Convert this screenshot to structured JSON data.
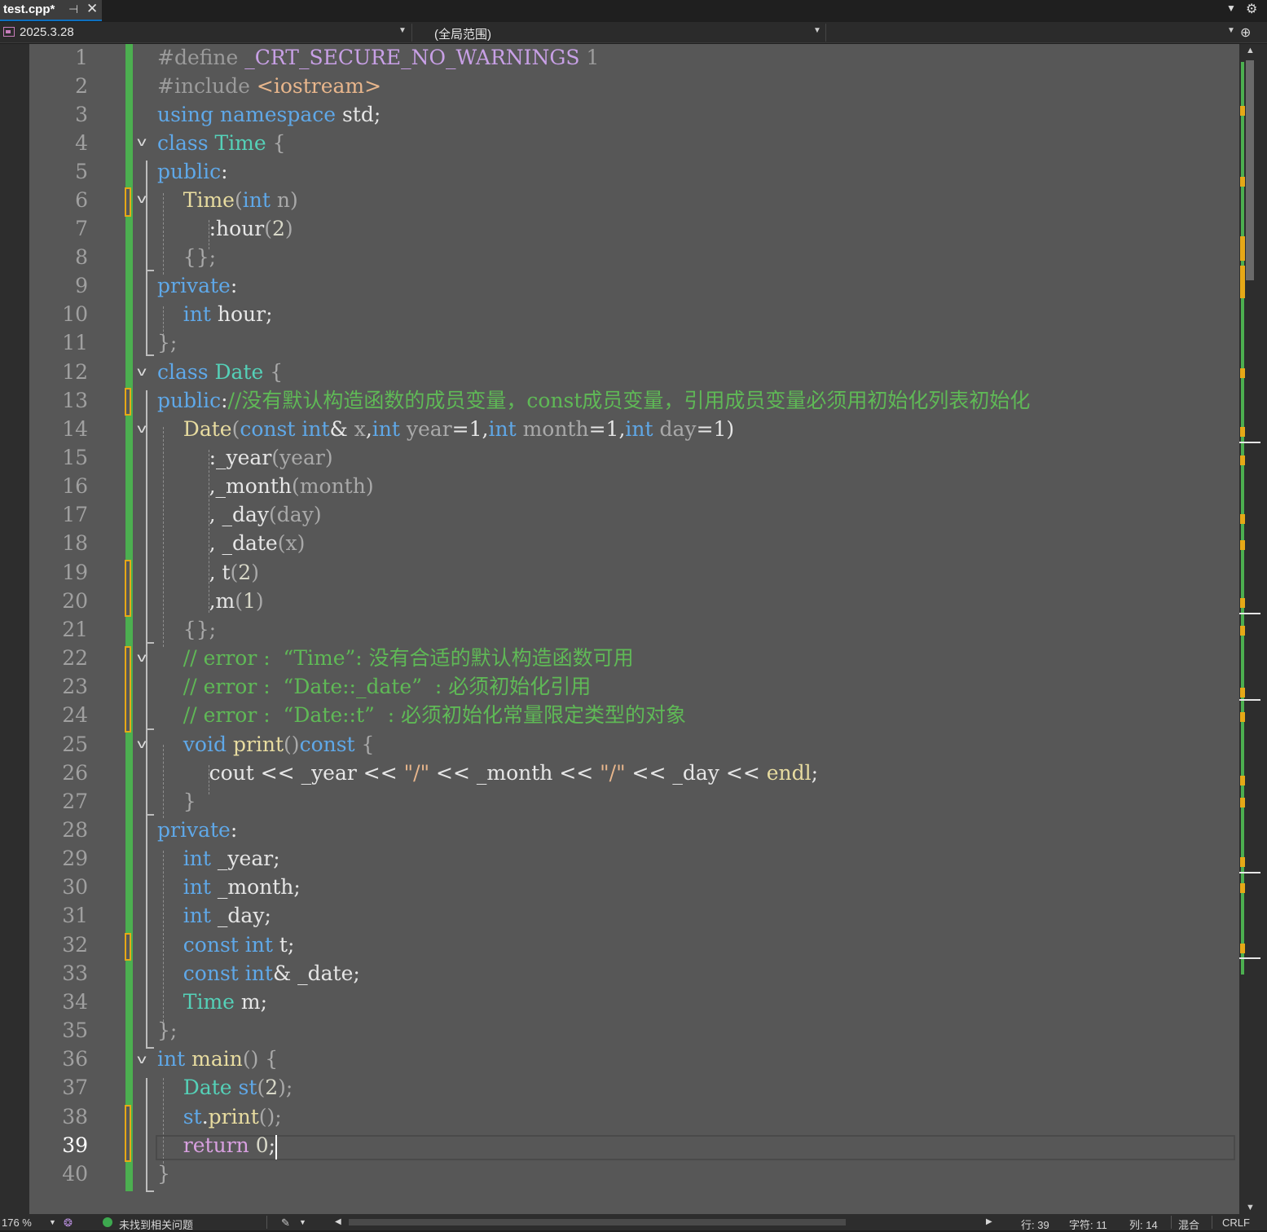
{
  "tab": {
    "title": "test.cpp*",
    "pin_icon": "pin-icon",
    "close_icon": "close-icon"
  },
  "nav": {
    "project": "2025.3.28",
    "scope": "(全局范围)",
    "member": ""
  },
  "editor": {
    "current_line": 39,
    "line_numbers": [
      "1",
      "2",
      "3",
      "4",
      "5",
      "6",
      "7",
      "8",
      "9",
      "10",
      "11",
      "12",
      "13",
      "14",
      "15",
      "16",
      "17",
      "18",
      "19",
      "20",
      "21",
      "22",
      "23",
      "24",
      "25",
      "26",
      "27",
      "28",
      "29",
      "30",
      "31",
      "32",
      "33",
      "34",
      "35",
      "36",
      "37",
      "38",
      "39",
      "40"
    ]
  },
  "code": {
    "l1": [
      "#define ",
      "_CRT_SECURE_NO_WARNINGS",
      " 1"
    ],
    "l2": [
      "#include ",
      "<iostream>"
    ],
    "l3": [
      "using",
      " ",
      "namespace",
      " std;"
    ],
    "l4": [
      "class",
      " ",
      "Time",
      " {"
    ],
    "l5": [
      "public",
      ":"
    ],
    "l6": [
      "    ",
      "Time",
      "(",
      "int",
      " ",
      "n",
      ")"
    ],
    "l7": [
      "        :",
      "hour",
      "(",
      "2",
      ")"
    ],
    "l8": [
      "    {};"
    ],
    "l9": [
      "private",
      ":"
    ],
    "l10": [
      "    ",
      "int",
      " hour;"
    ],
    "l11": [
      "};"
    ],
    "l12": [
      "class",
      " ",
      "Date",
      " {"
    ],
    "l13": [
      "public",
      ":",
      "//没有默认构造函数的成员变量，const成员变量，引用成员变量必须用初始化列表初始化"
    ],
    "l14": [
      "    ",
      "Date",
      "(",
      "const",
      " ",
      "int",
      "& ",
      "x",
      ",",
      "int",
      " ",
      "year",
      "=1,",
      "int",
      " ",
      "month",
      "=1,",
      "int",
      " ",
      "day",
      "=1)"
    ],
    "l15": [
      "        :",
      "_year",
      "(",
      "year",
      ")"
    ],
    "l16": [
      "        ,",
      "_month",
      "(",
      "month",
      ")"
    ],
    "l17": [
      "        , ",
      "_day",
      "(",
      "day",
      ")"
    ],
    "l18": [
      "        , ",
      "_date",
      "(",
      "x",
      ")"
    ],
    "l19": [
      "        , ",
      "t",
      "(",
      "2",
      ")"
    ],
    "l20": [
      "        ,",
      "m",
      "(",
      "1",
      ")"
    ],
    "l21": [
      "    {};"
    ],
    "l22": [
      "    ",
      "// error :  “Time”: 没有合适的默认构造函数可用"
    ],
    "l23": [
      "    ",
      "// error :  “Date::_date”  : 必须初始化引用"
    ],
    "l24": [
      "    ",
      "// error :  “Date::t”  : 必须初始化常量限定类型的对象"
    ],
    "l25": [
      "    ",
      "void",
      " ",
      "print",
      "()",
      "const",
      " {"
    ],
    "l26": [
      "        cout << ",
      "_year",
      " << ",
      "\"/\"",
      " << ",
      "_month",
      " << ",
      "\"/\"",
      " << ",
      "_day",
      " << ",
      "endl",
      ";"
    ],
    "l27": [
      "    }"
    ],
    "l28": [
      "private",
      ":"
    ],
    "l29": [
      "    ",
      "int",
      " ",
      "_year",
      ";"
    ],
    "l30": [
      "    ",
      "int",
      " ",
      "_month",
      ";"
    ],
    "l31": [
      "    ",
      "int",
      " ",
      "_day",
      ";"
    ],
    "l32": [
      "    ",
      "const",
      " ",
      "int",
      " ",
      "t",
      ";"
    ],
    "l33": [
      "    ",
      "const",
      " ",
      "int",
      "& ",
      "_date",
      ";"
    ],
    "l34": [
      "    ",
      "Time",
      " ",
      "m",
      ";"
    ],
    "l35": [
      "};"
    ],
    "l36": [
      "int",
      " ",
      "main",
      "() {"
    ],
    "l37": [
      "    ",
      "Date",
      " ",
      "st",
      "(",
      "2",
      ");"
    ],
    "l38": [
      "    ",
      "st",
      ".",
      "print",
      "();"
    ],
    "l39": [
      "    ",
      "return",
      " ",
      "0",
      ";"
    ],
    "l40": [
      "}"
    ]
  },
  "status": {
    "zoom": "176 %",
    "issues": "未找到相关问题",
    "line": "行: 39",
    "char": "字符: 11",
    "col": "列: 14",
    "indent": "混合",
    "eol": "CRLF"
  },
  "colors": {
    "editor_bg": "#575757",
    "keyword": "#5fa8e8",
    "type": "#55d1b8",
    "function": "#e8dca0",
    "comment": "#5fb956",
    "change_saved": "#4caf50",
    "change_unsaved": "#e6a817"
  }
}
